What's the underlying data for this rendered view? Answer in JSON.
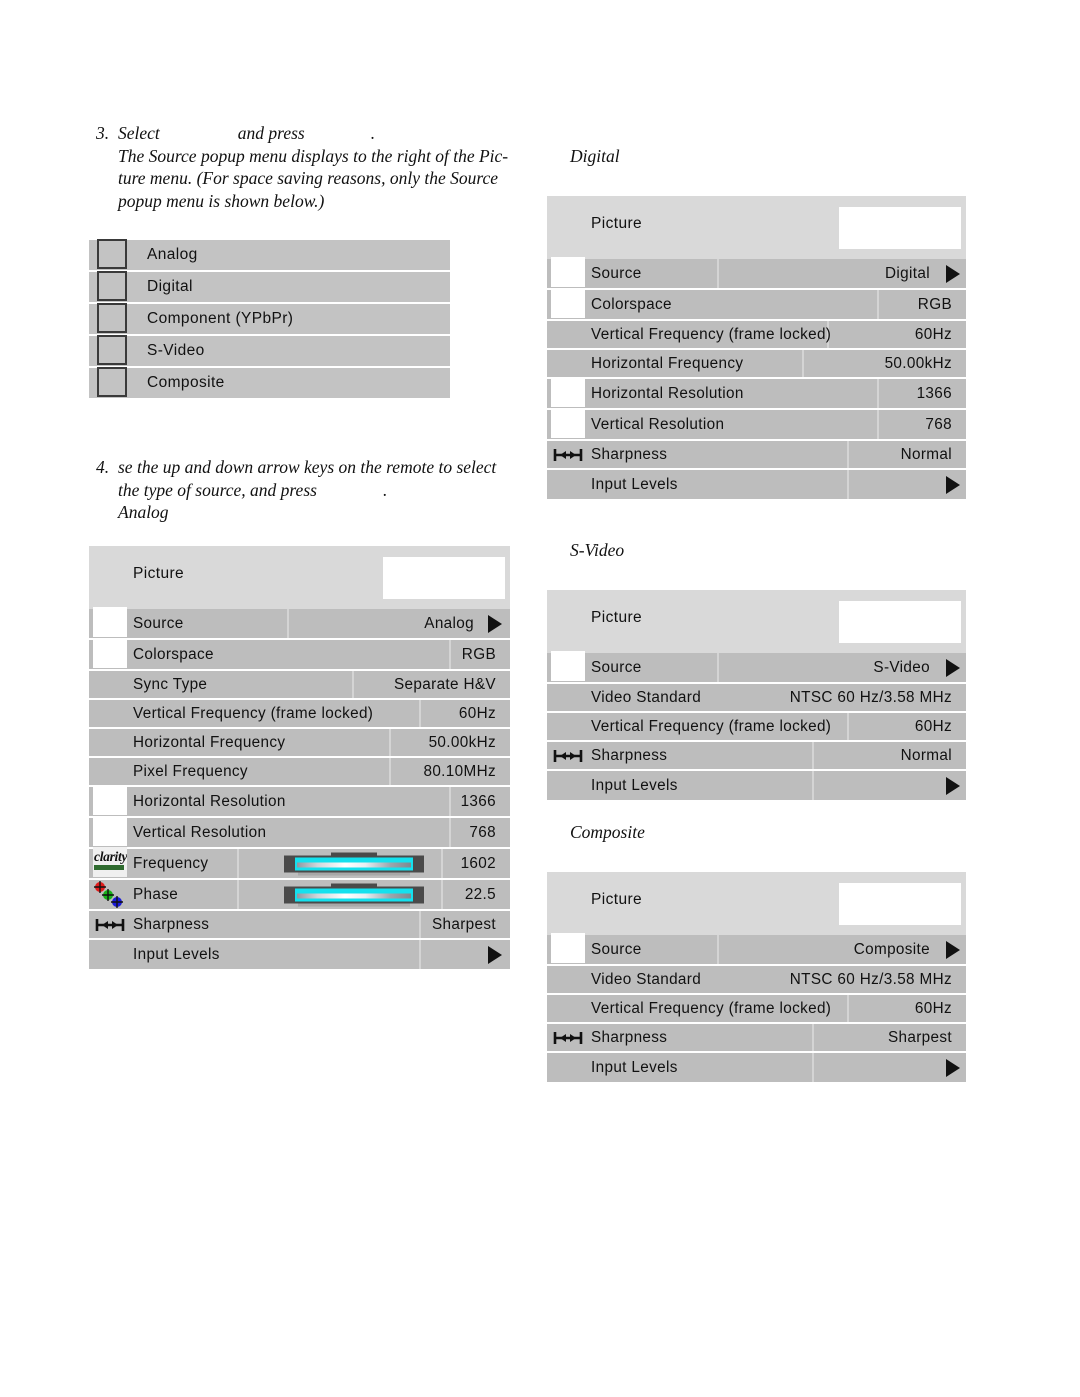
{
  "steps": [
    {
      "number": "3.",
      "lead_before": "Select",
      "lead_after": "and press",
      "lead_end": ".",
      "lines": [
        "The Source popup menu displays to the right of the Pic-",
        "ture menu. (For space saving reasons, only the Source",
        "popup menu is shown below.)"
      ]
    },
    {
      "number": "4.",
      "lines": [
        "se the up and down arrow keys on the remote to select",
        "the type of source, and press"
      ],
      "line_end": ".",
      "sub_caption": "Analog"
    }
  ],
  "source_popup": {
    "items": [
      {
        "label": "Analog"
      },
      {
        "label": "Digital"
      },
      {
        "label": "Component (YPbPr)"
      },
      {
        "label": "S-Video"
      },
      {
        "label": "Composite"
      }
    ]
  },
  "captions": {
    "digital": "Digital",
    "svideo": "S-Video",
    "composite": "Composite"
  },
  "panels": {
    "analog": {
      "header_title": "Picture",
      "rows": [
        {
          "label": "Source",
          "value": "Analog",
          "icon": "white-box",
          "arrow": true,
          "sep": 198
        },
        {
          "label": "Colorspace",
          "value": "RGB",
          "icon": "white-box",
          "arrow": false,
          "sep": 360
        },
        {
          "label": "Sync Type",
          "value": "Separate H&V",
          "icon": "none",
          "arrow": false,
          "sep": 263
        },
        {
          "label": "Vertical Frequency (frame locked)",
          "value": "60Hz",
          "icon": "none",
          "arrow": false,
          "sep": 330
        },
        {
          "label": "Horizontal Frequency",
          "value": "50.00kHz",
          "icon": "none",
          "arrow": false,
          "sep": 300
        },
        {
          "label": "Pixel Frequency",
          "value": "80.10MHz",
          "icon": "none",
          "arrow": false,
          "sep": 300
        },
        {
          "label": "Horizontal Resolution",
          "value": "1366",
          "icon": "white-box",
          "arrow": false,
          "sep": 360
        },
        {
          "label": "Vertical Resolution",
          "value": "768",
          "icon": "white-box",
          "arrow": false,
          "sep": 360
        },
        {
          "label": "Frequency",
          "value": "1602",
          "icon": "clarity-logo",
          "arrow": false,
          "slider": true,
          "sep": 148
        },
        {
          "label": "Phase",
          "value": "22.5",
          "icon": "rgb-dots",
          "arrow": false,
          "slider": true,
          "sep": 148
        },
        {
          "label": "Sharpness",
          "value": "Sharpest",
          "icon": "sharpness",
          "arrow": false,
          "sep": 330
        },
        {
          "label": "Input Levels",
          "value": "",
          "icon": "none",
          "arrow": true,
          "sep": 330
        }
      ]
    },
    "digital": {
      "header_title": "Picture",
      "rows": [
        {
          "label": "Source",
          "value": "Digital",
          "icon": "white-box",
          "arrow": true,
          "sep": 170
        },
        {
          "label": "Colorspace",
          "value": "RGB",
          "icon": "white-box",
          "arrow": false,
          "sep": 330
        },
        {
          "label": "Vertical Frequency (frame locked)",
          "value": "60Hz",
          "icon": "none",
          "arrow": false,
          "sep": 280
        },
        {
          "label": "Horizontal Frequency",
          "value": "50.00kHz",
          "icon": "none",
          "arrow": false,
          "sep": 255
        },
        {
          "label": "Horizontal Resolution",
          "value": "1366",
          "icon": "white-box",
          "arrow": false,
          "sep": 330
        },
        {
          "label": "Vertical Resolution",
          "value": "768",
          "icon": "white-box",
          "arrow": false,
          "sep": 330
        },
        {
          "label": "Sharpness",
          "value": "Normal",
          "icon": "sharpness",
          "arrow": false,
          "sep": 300
        },
        {
          "label": "Input Levels",
          "value": "",
          "icon": "none",
          "arrow": true,
          "sep": 300
        }
      ]
    },
    "svideo": {
      "header_title": "Picture",
      "rows": [
        {
          "label": "Source",
          "value": "S-Video",
          "icon": "white-box",
          "arrow": true,
          "sep": 170
        },
        {
          "label": "Video Standard",
          "value": "NTSC 60 Hz/3.58 MHz",
          "icon": "none",
          "arrow": false,
          "sep": 0,
          "value_center": true
        },
        {
          "label": "Vertical Frequency (frame locked)",
          "value": "60Hz",
          "icon": "none",
          "arrow": false,
          "sep": 300
        },
        {
          "label": "Sharpness",
          "value": "Normal",
          "icon": "sharpness",
          "arrow": false,
          "sep": 265
        },
        {
          "label": "Input Levels",
          "value": "",
          "icon": "none",
          "arrow": true,
          "sep": 265
        }
      ]
    },
    "composite": {
      "header_title": "Picture",
      "rows": [
        {
          "label": "Source",
          "value": "Composite",
          "icon": "white-box",
          "arrow": true,
          "sep": 170
        },
        {
          "label": "Video Standard",
          "value": "NTSC 60 Hz/3.58 MHz",
          "icon": "none",
          "arrow": false,
          "sep": 0,
          "value_center": true
        },
        {
          "label": "Vertical Frequency (frame locked)",
          "value": "60Hz",
          "icon": "none",
          "arrow": false,
          "sep": 300
        },
        {
          "label": "Sharpness",
          "value": "Sharpest",
          "icon": "sharpness",
          "arrow": false,
          "sep": 265
        },
        {
          "label": "Input Levels",
          "value": "",
          "icon": "none",
          "arrow": true,
          "sep": 265
        }
      ]
    }
  },
  "colors": {
    "row_bg": "#bdbdbd",
    "header_bg": "#d9d9d9",
    "popup_bg": "#c3c3c3",
    "slider_fill": "#14e1ee",
    "slider_track": "#4a4a4a",
    "text": "#111111",
    "separator": "#d4d4d4"
  }
}
